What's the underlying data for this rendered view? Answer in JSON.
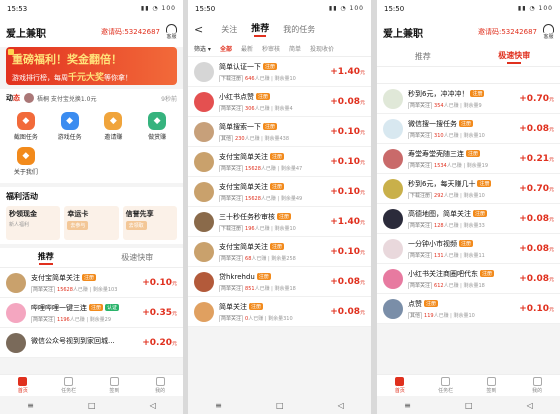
{
  "colors": {
    "accent": "#e0301e",
    "tag_orange": "#f28a1b",
    "tag_green": "#2ab36a"
  },
  "phone1": {
    "status": {
      "time": "15:53",
      "battery": "100"
    },
    "app_title": "爱上兼职",
    "invite_code": "邀请码:53242687",
    "service_label": "客服",
    "banner": {
      "line1": "重磅福利！奖金翻倍！",
      "line2_pre": "游戏排行榜，每周",
      "line2_hl": "千元大奖",
      "line2_post": "等你拿！"
    },
    "dynamic": {
      "label_main": "动",
      "label_accent": "态",
      "text": "梧桐 支付宝兑换1.0元",
      "time": "9秒前"
    },
    "grid": [
      {
        "label": "截图任务",
        "icon": "screenshot-icon",
        "color": "#f26a3a"
      },
      {
        "label": "游戏任务",
        "icon": "gamepad-icon",
        "color": "#3b8cf0"
      },
      {
        "label": "邀请赚",
        "icon": "invite-icon",
        "color": "#f0a43b"
      },
      {
        "label": "做赏赚",
        "icon": "reward-icon",
        "color": "#36b37e"
      },
      {
        "label": "关于我们",
        "icon": "about-icon",
        "color": "#f28a1b"
      }
    ],
    "welfare": {
      "title": "福利活动",
      "cards": [
        {
          "title": "秒领现金",
          "sub": "新人福利",
          "chip": ""
        },
        {
          "title": "幸运卡",
          "sub": "",
          "chip": "去参与"
        },
        {
          "title": "信誉先享",
          "sub": "",
          "chip": "去领取"
        }
      ]
    },
    "tabs": {
      "recommend": "推荐",
      "fast": "极速快审"
    },
    "tasks": [
      {
        "title": "支付宝简单关注",
        "tag": "注册",
        "tag_color": "orange",
        "avatar": "#c9a16c",
        "type": "简单关注",
        "done": "15628",
        "left": "103",
        "price": "+0.10"
      },
      {
        "title": "哔哩哔哩一键三连",
        "tag": "注册",
        "tag_color": "orange",
        "tag2": "认证",
        "avatar": "#f4a6c0",
        "type": "简单关注",
        "done": "1196",
        "left": "29",
        "price": "+0.35"
      },
      {
        "title": "微信公众号视到到家回城...",
        "tag": "",
        "tag_color": "orange",
        "avatar": "#7a6a5a",
        "type": "",
        "done": "",
        "left": "",
        "price": "+0.20"
      }
    ],
    "bottom_nav": [
      "首页",
      "任务栏",
      "签到",
      "我的"
    ]
  },
  "phone2": {
    "status": {
      "time": "15:50",
      "battery": "100"
    },
    "back": "<",
    "tabs": [
      "关注",
      "推荐",
      "我的任务"
    ],
    "filters": {
      "sx": "筛选",
      "items": [
        "全部",
        "最新",
        "秒审核",
        "简单",
        "投现收价"
      ]
    },
    "tasks": [
      {
        "title": "简单认证一下",
        "tag": "注册",
        "avatar": "#d6d6d6",
        "type": "下载注册",
        "done": "646",
        "left": "10",
        "price": "+1.40"
      },
      {
        "title": "小红书点赞",
        "tag": "注册",
        "avatar": "#e45050",
        "type": "简单关注",
        "done": "306",
        "left": "4",
        "price": "+0.08"
      },
      {
        "title": "简单搜索一下",
        "tag": "注册",
        "avatar": "#c7a07a",
        "type": "其他",
        "done": "230",
        "left": "438",
        "price": "+0.10"
      },
      {
        "title": "支付宝简单关注",
        "tag": "注册",
        "avatar": "#c9a16c",
        "type": "简单关注",
        "done": "15628",
        "left": "47",
        "price": "+0.10"
      },
      {
        "title": "支付宝简单关注",
        "tag": "注册",
        "avatar": "#c9a16c",
        "type": "简单关注",
        "done": "15628",
        "left": "49",
        "price": "+0.10"
      },
      {
        "title": "三十秒任务秒审核",
        "tag": "注册",
        "avatar": "#8a6a4a",
        "type": "下载注册",
        "done": "196",
        "left": "10",
        "price": "+1.40"
      },
      {
        "title": "支付宝简单关注",
        "tag": "注册",
        "avatar": "#c9a16c",
        "type": "简单关注",
        "done": "68",
        "left": "258",
        "price": "+0.10"
      },
      {
        "title": "贷hkrehdu",
        "tag": "注册",
        "avatar": "#b35a3a",
        "type": "简单关注",
        "done": "851",
        "left": "18",
        "price": "+0.08"
      },
      {
        "title": "简单关注",
        "tag": "注册",
        "avatar": "#e0a060",
        "type": "简单关注",
        "done": "0",
        "left": "310",
        "price": "+0.08"
      }
    ]
  },
  "phone3": {
    "status": {
      "time": "15:50",
      "battery": "100"
    },
    "app_title": "爱上兼职",
    "invite_code": "邀请码:53242687",
    "service_label": "客服",
    "tabs": {
      "recommend": "推荐",
      "fast": "极速快审"
    },
    "tasks": [
      {
        "title": "秒到6元，冲冲冲！",
        "tag": "注册",
        "avatar": "#e0e8d8",
        "type": "简单关注",
        "done": "354",
        "left": "9",
        "price": "+0.70"
      },
      {
        "title": "微信搜一搜任务",
        "tag": "注册",
        "avatar": "#d8e8f0",
        "type": "简单关注",
        "done": "310",
        "left": "10",
        "price": "+0.08"
      },
      {
        "title": "寿堂寿堂壳随三连",
        "tag": "注册",
        "avatar": "#c96a6a",
        "type": "简单关注",
        "done": "1534",
        "left": "19",
        "price": "+0.21"
      },
      {
        "title": "秒到6元，每天赚几十",
        "tag": "注册",
        "avatar": "#c9b04a",
        "type": "下载注册",
        "done": "292",
        "left": "10",
        "price": "+0.70"
      },
      {
        "title": "高德地图，简单关注",
        "tag": "注册",
        "avatar": "#2b2b3b",
        "type": "简单关注",
        "done": "128",
        "left": "33",
        "price": "+0.08"
      },
      {
        "title": "一分钟小市视频",
        "tag": "注册",
        "avatar": "#e9d8dc",
        "type": "简单关注",
        "done": "131",
        "left": "11",
        "price": "+0.08"
      },
      {
        "title": "小红书关注商圈吧代东",
        "tag": "注册",
        "avatar": "#e77aa0",
        "type": "简单关注",
        "done": "612",
        "left": "18",
        "price": "+0.08"
      },
      {
        "title": "点赞",
        "tag": "注册",
        "avatar": "#7a8ea8",
        "type": "其他",
        "done": "119",
        "left": "10",
        "price": "+0.10"
      }
    ],
    "bottom_nav": [
      "首页",
      "任务栏",
      "签到",
      "我的"
    ]
  },
  "labels": {
    "done_suffix": "人已赚",
    "left_prefix": "剩余量",
    "unit": "元"
  }
}
